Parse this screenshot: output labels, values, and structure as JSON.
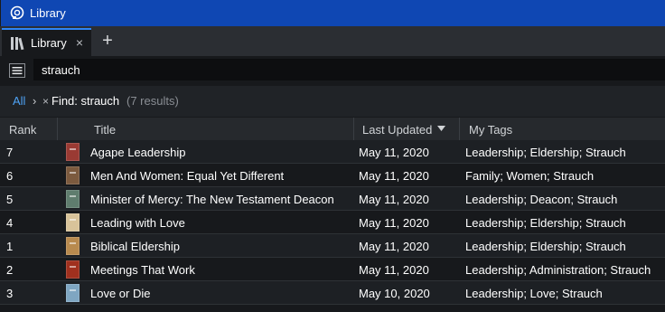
{
  "window": {
    "title": "Library"
  },
  "tabs": [
    {
      "label": "Library",
      "close": "×"
    }
  ],
  "new_tab_label": "+",
  "search": {
    "value": "strauch"
  },
  "breadcrumb": {
    "all": "All",
    "separator": "›",
    "remove": "×",
    "find": "Find: strauch",
    "count": "(7 results)"
  },
  "columns": {
    "rank": "Rank",
    "title": "Title",
    "last_updated": "Last Updated",
    "my_tags": "My Tags"
  },
  "sort": {
    "column": "Last Updated",
    "direction": "descending"
  },
  "rows": [
    {
      "rank": "7",
      "title": "Agape Leadership",
      "updated": "May 11, 2020",
      "tags": "Leadership; Eldership; Strauch",
      "cover_color": "#9a3a33"
    },
    {
      "rank": "6",
      "title": "Men And Women: Equal Yet Different",
      "updated": "May 11, 2020",
      "tags": "Family; Women; Strauch",
      "cover_color": "#7c5a3e"
    },
    {
      "rank": "5",
      "title": "Minister of Mercy: The New Testament Deacon",
      "updated": "May 11, 2020",
      "tags": "Leadership; Deacon; Strauch",
      "cover_color": "#5f7d6e"
    },
    {
      "rank": "4",
      "title": "Leading with Love",
      "updated": "May 11, 2020",
      "tags": "Leadership; Eldership; Strauch",
      "cover_color": "#d8c39a"
    },
    {
      "rank": "1",
      "title": "Biblical Eldership",
      "updated": "May 11, 2020",
      "tags": "Leadership; Eldership; Strauch",
      "cover_color": "#b88a4e"
    },
    {
      "rank": "2",
      "title": "Meetings That Work",
      "updated": "May 11, 2020",
      "tags": "Leadership; Administration; Strauch",
      "cover_color": "#a0301e"
    },
    {
      "rank": "3",
      "title": "Love or Die",
      "updated": "May 10, 2020",
      "tags": "Leadership; Love; Strauch",
      "cover_color": "#7fa6c2"
    }
  ],
  "colors": {
    "titlebar": "#0f47b3",
    "accent": "#2f86f6",
    "link": "#4ea3f5",
    "background": "#17191c"
  },
  "icons": {
    "app": "logos-app-icon",
    "library": "library-books-icon",
    "menu": "hamburger-menu-icon",
    "sort": "sort-descending-icon"
  }
}
